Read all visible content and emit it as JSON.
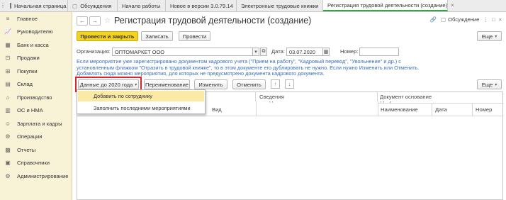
{
  "tabs": [
    {
      "label": "Начальная страница",
      "active": false
    },
    {
      "label": "Обсуждения",
      "active": false
    },
    {
      "label": "Начало работы",
      "active": false
    },
    {
      "label": "Новое в версии 3.0.79.14",
      "active": false
    },
    {
      "label": "Электронные трудовые книжки",
      "active": false
    },
    {
      "label": "Регистрация трудовой деятельности (создание)",
      "active": true
    }
  ],
  "sidebar": {
    "items": [
      {
        "label": "Главное",
        "icon": "menu-lines-icon"
      },
      {
        "label": "Руководителю",
        "icon": "chart-icon"
      },
      {
        "label": "Банк и касса",
        "icon": "bank-icon"
      },
      {
        "label": "Продажи",
        "icon": "cart-icon"
      },
      {
        "label": "Покупки",
        "icon": "basket-icon"
      },
      {
        "label": "Склад",
        "icon": "warehouse-icon"
      },
      {
        "label": "Производство",
        "icon": "factory-icon"
      },
      {
        "label": "ОС и НМА",
        "icon": "building-icon"
      },
      {
        "label": "Зарплата и кадры",
        "icon": "people-icon"
      },
      {
        "label": "Операции",
        "icon": "operations-icon"
      },
      {
        "label": "Отчеты",
        "icon": "report-icon"
      },
      {
        "label": "Справочники",
        "icon": "book-icon"
      },
      {
        "label": "Администрирование",
        "icon": "gear-icon"
      }
    ]
  },
  "header": {
    "title": "Регистрация трудовой деятельности (создание)",
    "discussions": "Обсуждение"
  },
  "toolbar": {
    "post_and_close": "Провести и закрыть",
    "save": "Записать",
    "post": "Провести",
    "more": "Еще"
  },
  "form": {
    "organization_label": "Организация:",
    "organization_value": "ОПТОМАРКЕТ ООО",
    "date_label": "Дата:",
    "date_value": "03.07.2020",
    "number_label": "Номер:",
    "number_value": ""
  },
  "info_text": "Если мероприятие уже зарегистрировано документом кадрового учета (\"Прием на работу\", \"Кадровый перевод\", \"Увольнение\" и др.) с установленным флажком \"Отразить в трудовой книжке\", то в этом документе его дублировать не нужно. Если нужно Изменить или Отменить. Добавлять сюда можно мероприятия, для которых не предусмотрено документа кадрового документа.",
  "table_toolbar": {
    "data_before_2020": "Данные до 2020 года",
    "rename": "Переименование",
    "edit": "Изменить",
    "cancel": "Отменить",
    "more": "Еще"
  },
  "dropdown": {
    "items": [
      "Добавить по сотруднику",
      "Заполнить последними мероприятиями"
    ],
    "selected_index": 0
  },
  "table": {
    "col_type": "Вид",
    "col_info": "Сведения",
    "col_basis_doc": "Документ основание",
    "col_name": "Наименование",
    "col_date": "Дата",
    "col_number": "Номер"
  },
  "colors": {
    "accent_yellow": "#f5d21e",
    "highlight_red": "#d9252b",
    "info_blue": "#3a6fb5",
    "sidebar_bg": "#f8f3d6"
  }
}
